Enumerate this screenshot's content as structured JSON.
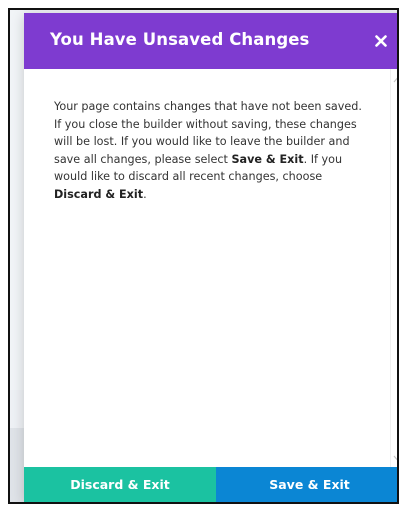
{
  "modal": {
    "title": "You Have Unsaved Changes",
    "close_icon": "close-icon",
    "body": {
      "part1": "Your page contains changes that have not been saved. If you close the builder without saving, these changes will be lost. If you would like to leave the builder and save all changes, please select ",
      "bold1": "Save & Exit",
      "part2": ". If you would like to discard all recent changes, choose ",
      "bold2": "Discard & Exit",
      "part3": "."
    },
    "footer": {
      "discard_label": "Discard & Exit",
      "save_label": "Save & Exit"
    }
  },
  "colors": {
    "header": "#7e3bd0",
    "discard": "#1bc2a1",
    "save": "#0b86d4"
  }
}
